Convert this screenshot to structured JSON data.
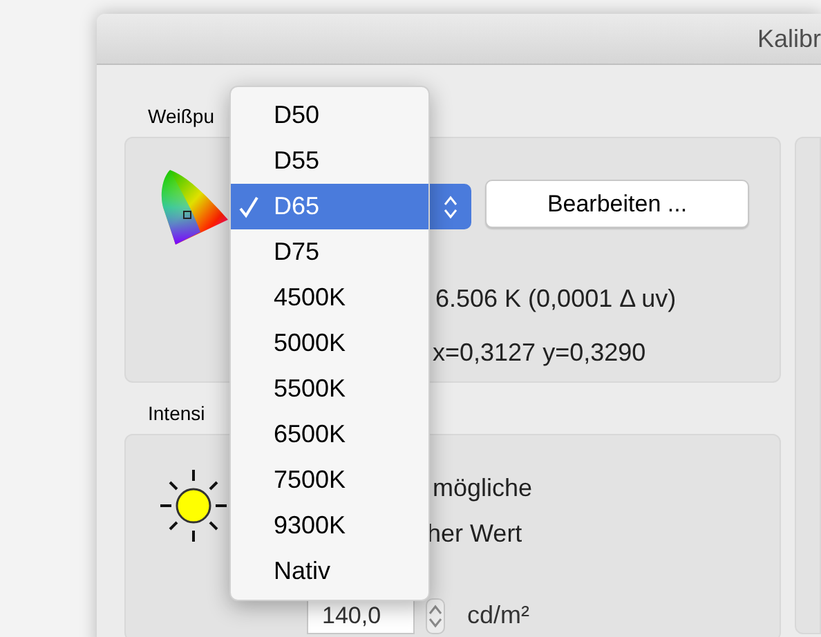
{
  "window": {
    "title": "Kalibr"
  },
  "whitepoint": {
    "label": "Weißpu",
    "edit_button": "Bearbeiten ...",
    "temperature": "6.506 K (0,0001 Δ uv)",
    "chromaticity": "x=0,3127 y=0,3290"
  },
  "intensity": {
    "label": "Intensi",
    "option_1": "mögliche",
    "option_2": "her Wert",
    "value": "140,0",
    "unit": "cd/m²"
  },
  "menu": {
    "items": [
      {
        "label": "D50",
        "selected": false
      },
      {
        "label": "D55",
        "selected": false
      },
      {
        "label": "D65",
        "selected": true
      },
      {
        "label": "D75",
        "selected": false
      },
      {
        "label": "4500K",
        "selected": false
      },
      {
        "label": "5000K",
        "selected": false
      },
      {
        "label": "5500K",
        "selected": false
      },
      {
        "label": "6500K",
        "selected": false
      },
      {
        "label": "7500K",
        "selected": false
      },
      {
        "label": "9300K",
        "selected": false
      },
      {
        "label": "Nativ",
        "selected": false
      }
    ]
  }
}
